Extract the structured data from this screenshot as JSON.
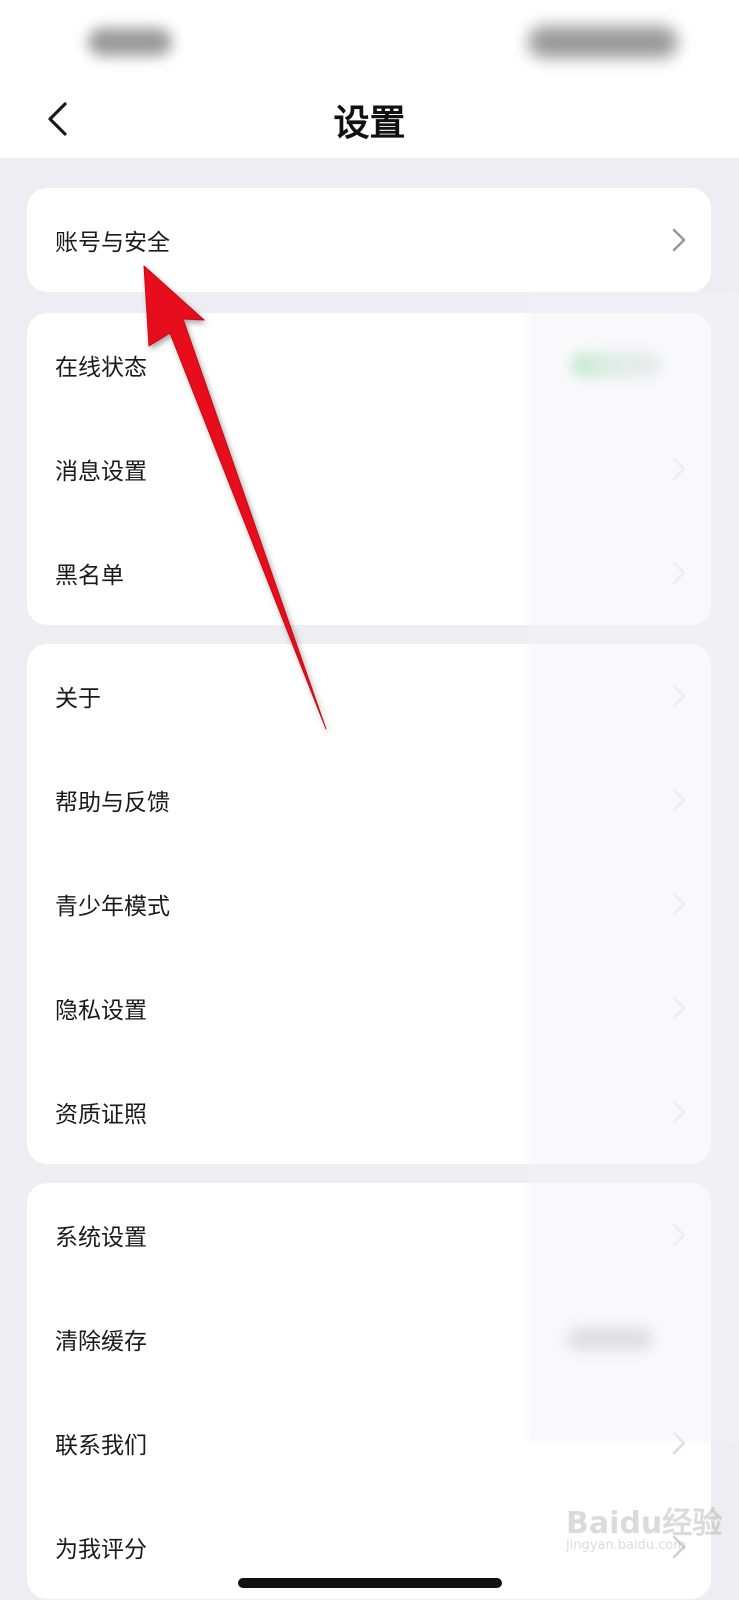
{
  "header": {
    "title": "设置"
  },
  "groups": [
    {
      "items": [
        {
          "label": "账号与安全"
        }
      ]
    },
    {
      "items": [
        {
          "label": "在线状态"
        },
        {
          "label": "消息设置"
        },
        {
          "label": "黑名单"
        }
      ]
    },
    {
      "items": [
        {
          "label": "关于"
        },
        {
          "label": "帮助与反馈"
        },
        {
          "label": "青少年模式"
        },
        {
          "label": "隐私设置"
        },
        {
          "label": "资质证照"
        }
      ]
    },
    {
      "items": [
        {
          "label": "系统设置"
        },
        {
          "label": "清除缓存"
        },
        {
          "label": "联系我们"
        },
        {
          "label": "为我评分"
        }
      ]
    }
  ],
  "watermark": {
    "text": "Baidu经验",
    "sub": "jingyan.baidu.com"
  },
  "colors": {
    "background": "#EEEEF2",
    "card": "#FFFFFF",
    "annotation_arrow": "#E8101B"
  },
  "icons": {
    "back": "chevron-left-icon",
    "row": "chevron-right-icon"
  }
}
